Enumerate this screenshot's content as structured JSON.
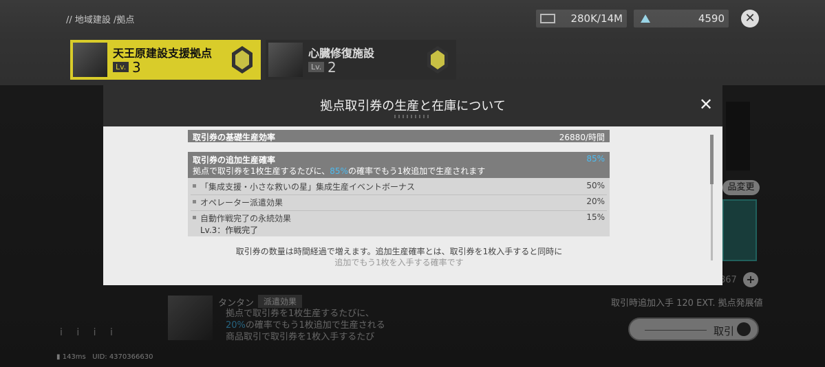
{
  "breadcrumb": "// 地域建設 /拠点",
  "resources": {
    "res1_value": "280K/14M",
    "res2_value": "4590"
  },
  "bases": [
    {
      "name": "天王原建設支援拠点",
      "lv_label": "Lv.",
      "lv": "3"
    },
    {
      "name": "心臓修復施設",
      "lv_label": "Lv.",
      "lv": "2"
    }
  ],
  "background": {
    "change_button": "品変更",
    "quantity": "867",
    "bonus_line": "取引時追加入手 120 EXT. 拠点発展値",
    "trade_button": "取引",
    "operator_name": "タンタン",
    "operator_tag": "派遣効果",
    "operator_desc_1": "拠点で取引券を1枚生産するたびに、",
    "operator_desc_2_hl": "20%",
    "operator_desc_2": "の確率でもう1枚追加で生産される",
    "operator_desc_3": "商品取引で取引券を1枚入手するたび",
    "ping": "143ms",
    "uid": "UID: 4370366630",
    "ticks": "i i i i"
  },
  "modal": {
    "title": "拠点取引券の生産と在庫について",
    "base_rate_label": "取引券の基礎生産効率",
    "base_rate_value": "26880/時間",
    "add_rate_label": "取引券の追加生産確率",
    "add_rate_value": "85%",
    "add_rate_desc_pre": "拠点で取引券を1枚生産するたびに、",
    "add_rate_desc_hl": "85%",
    "add_rate_desc_post": "の確率でもう1枚追加で生産されます",
    "bonuses": [
      {
        "label": "「集成支援・小さな救いの星」集成生産イベントボーナス",
        "value": "50%"
      },
      {
        "label": "オペレーター派遣効果",
        "value": "20%"
      },
      {
        "label": "自動作戦完了の永続効果",
        "value": "15%",
        "sub": "Lv.3：作戦完了"
      }
    ],
    "note_1": "取引券の数量は時間経過で増えます。追加生産確率とは、取引券を1枚入手すると同時に",
    "note_2": "追加でもう1枚を入手する確率です"
  },
  "colors": {
    "accent_yellow": "#d9cc2a",
    "highlight_blue": "#4dbbf0"
  }
}
